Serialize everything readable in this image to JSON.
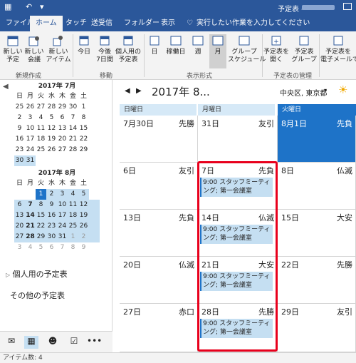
{
  "titlebar": {
    "title": "予定表 -",
    "app_icon": "calendar-app-icon"
  },
  "tabs": [
    "ファイル",
    "ホーム",
    "タッチ",
    "送受信",
    "フォルダー",
    "表示"
  ],
  "tell_me": "実行したい作業を入力してください",
  "ribbon": {
    "new_appointment": "新しい\n予定",
    "new_meeting": "新しい\n会議",
    "new_items": "新しい\nアイテム",
    "today": "今日",
    "next7": "今後\n7日間",
    "personal": "個人用の\n予定表",
    "day": "日",
    "workweek": "稼働日",
    "week": "週",
    "month": "月",
    "group_schedule": "グループ\nスケジュール",
    "open_calendar": "予定表を\n開く",
    "calendar_groups": "予定表\nグループ",
    "email_calendar": "予定表を\n電子メールで送",
    "group_new": "新規作成",
    "group_goto": "移動",
    "group_arrange": "表示形式",
    "group_manage": "予定表の管理"
  },
  "minical": {
    "weekdays": [
      "日",
      "月",
      "火",
      "水",
      "木",
      "金",
      "土"
    ],
    "july": {
      "header": "2017年 7月",
      "rows": [
        [
          "25",
          "26",
          "27",
          "28",
          "29",
          "30",
          "1"
        ],
        [
          "2",
          "3",
          "4",
          "5",
          "6",
          "7",
          "8"
        ],
        [
          "9",
          "10",
          "11",
          "12",
          "13",
          "14",
          "15"
        ],
        [
          "16",
          "17",
          "18",
          "19",
          "20",
          "21",
          "22"
        ],
        [
          "23",
          "24",
          "25",
          "26",
          "27",
          "28",
          "29"
        ],
        [
          "30",
          "31"
        ]
      ]
    },
    "august": {
      "header": "2017年 8月",
      "rows": [
        [
          "",
          "",
          "1",
          "2",
          "3",
          "4",
          "5"
        ],
        [
          "6",
          "7",
          "8",
          "9",
          "10",
          "11",
          "12"
        ],
        [
          "13",
          "14",
          "15",
          "16",
          "17",
          "18",
          "19"
        ],
        [
          "20",
          "21",
          "22",
          "23",
          "24",
          "25",
          "26"
        ],
        [
          "27",
          "28",
          "29",
          "30",
          "31",
          "1",
          "2"
        ],
        [
          "3",
          "4",
          "5",
          "6",
          "7",
          "8",
          "9"
        ]
      ]
    }
  },
  "nav": {
    "personal_calendars": "個人用の予定表",
    "other_calendars": "その他の予定表"
  },
  "calendar": {
    "title": "2017年 8...",
    "location": "中央区, 東京都",
    "days": [
      "日曜日",
      "月曜日",
      "火曜日"
    ],
    "rows": [
      [
        {
          "date": "7月30日",
          "rokuyo": "先勝"
        },
        {
          "date": "31日",
          "rokuyo": "友引"
        },
        {
          "date": "8月1日",
          "rokuyo": "先負"
        }
      ],
      [
        {
          "date": "6日",
          "rokuyo": "友引"
        },
        {
          "date": "7日",
          "rokuyo": "先負"
        },
        {
          "date": "8日",
          "rokuyo": "仏滅"
        }
      ],
      [
        {
          "date": "13日",
          "rokuyo": "先負"
        },
        {
          "date": "14日",
          "rokuyo": "仏滅"
        },
        {
          "date": "15日",
          "rokuyo": "大安"
        }
      ],
      [
        {
          "date": "20日",
          "rokuyo": "仏滅"
        },
        {
          "date": "21日",
          "rokuyo": "大安"
        },
        {
          "date": "22日",
          "rokuyo": "先勝"
        }
      ],
      [
        {
          "date": "27日",
          "rokuyo": "赤口"
        },
        {
          "date": "28日",
          "rokuyo": "先勝"
        },
        {
          "date": "29日",
          "rokuyo": "友引"
        }
      ]
    ],
    "appointment": "9:00 スタッフミーティング; 第一会議室"
  },
  "status": "アイテム数: 4",
  "colors": {
    "accent": "#2b579a",
    "today": "#1e73c8",
    "highlight": "#e8001c"
  }
}
